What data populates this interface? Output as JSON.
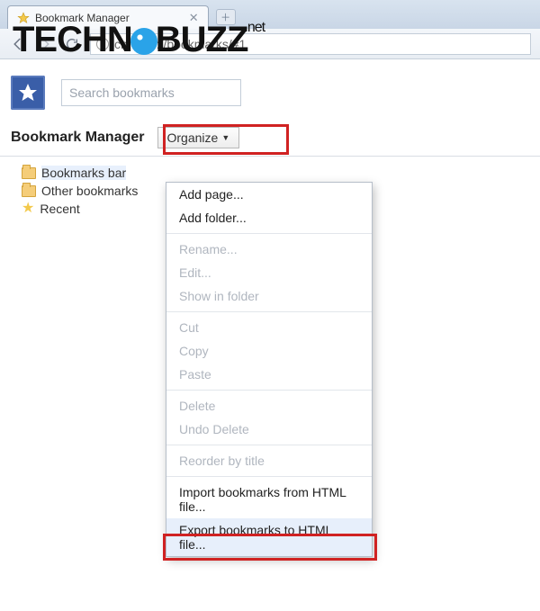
{
  "tab": {
    "title": "Bookmark Manager"
  },
  "address": {
    "url": "chrome://bookmarks/#1"
  },
  "watermark": {
    "pre": "TECHN",
    "post": "BUZZ",
    "suffix": ".net"
  },
  "header": {
    "search_placeholder": "Search bookmarks"
  },
  "toolbar": {
    "title": "Bookmark Manager",
    "organize_label": "Organize"
  },
  "sidebar": {
    "items": [
      {
        "label": "Bookmarks bar"
      },
      {
        "label": "Other bookmarks"
      },
      {
        "label": "Recent"
      }
    ]
  },
  "menu": {
    "add_page": "Add page...",
    "add_folder": "Add folder...",
    "rename": "Rename...",
    "edit": "Edit...",
    "show_in_folder": "Show in folder",
    "cut": "Cut",
    "copy": "Copy",
    "paste": "Paste",
    "delete": "Delete",
    "undo_delete": "Undo Delete",
    "reorder": "Reorder by title",
    "import": "Import bookmarks from HTML file...",
    "export": "Export bookmarks to HTML file..."
  }
}
